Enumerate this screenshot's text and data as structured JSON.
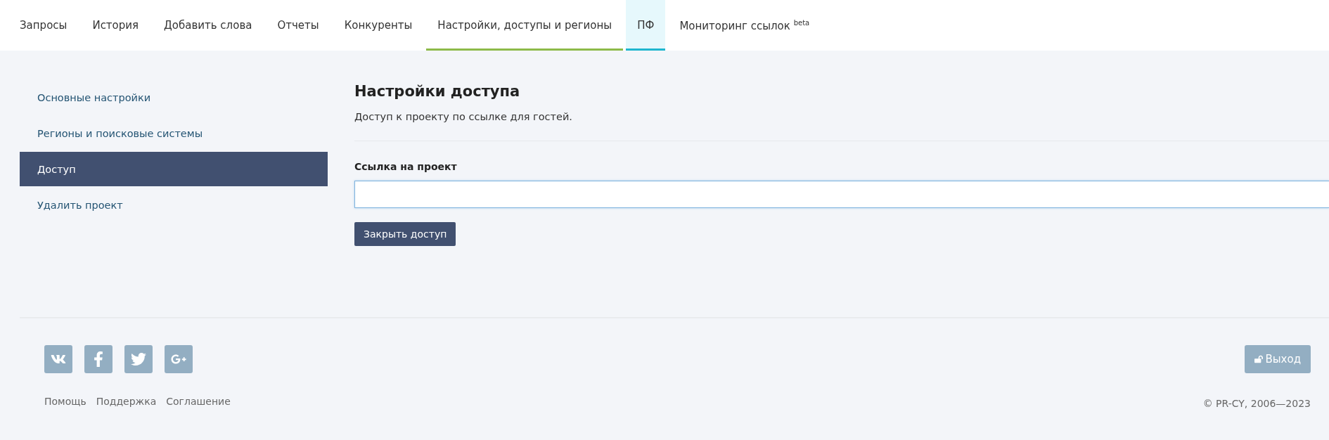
{
  "tabs": [
    {
      "label": "Запросы",
      "selected": false,
      "highlighted": false
    },
    {
      "label": "История",
      "selected": false,
      "highlighted": false
    },
    {
      "label": "Добавить слова",
      "selected": false,
      "highlighted": false
    },
    {
      "label": "Отчеты",
      "selected": false,
      "highlighted": false
    },
    {
      "label": "Конкуренты",
      "selected": false,
      "highlighted": false
    },
    {
      "label": "Настройки, доступы и регионы",
      "selected": true,
      "highlighted": false
    },
    {
      "label": "ПФ",
      "selected": false,
      "highlighted": true
    },
    {
      "label": "Мониторинг ссылок $^{beta}$",
      "selected": false,
      "highlighted": false
    }
  ],
  "sidebar": {
    "items": [
      {
        "label": "Основные настройки",
        "selected": false
      },
      {
        "label": "Регионы и поисковые системы",
        "selected": false
      },
      {
        "label": "Доступ",
        "selected": true
      },
      {
        "label": "Удалить проект",
        "selected": false
      }
    ]
  },
  "main": {
    "title": "Настройки доступа",
    "description": "Доступ к проекту по ссылке для гостей.",
    "field": {
      "label": "Ссылка на проект",
      "focused": true
    },
    "button": "Закрыть доступ"
  },
  "footer": {
    "social": [
      {
        "kind": "vk"
      },
      {
        "kind": "facebook"
      },
      {
        "kind": "twitter"
      },
      {
        "kind": "google-plus"
      }
    ],
    "links": [
      "Помощь",
      "Поддержка",
      "Соглашение"
    ],
    "logout": "Выход",
    "copyright": "© PR-CY, 2006—2023"
  }
}
